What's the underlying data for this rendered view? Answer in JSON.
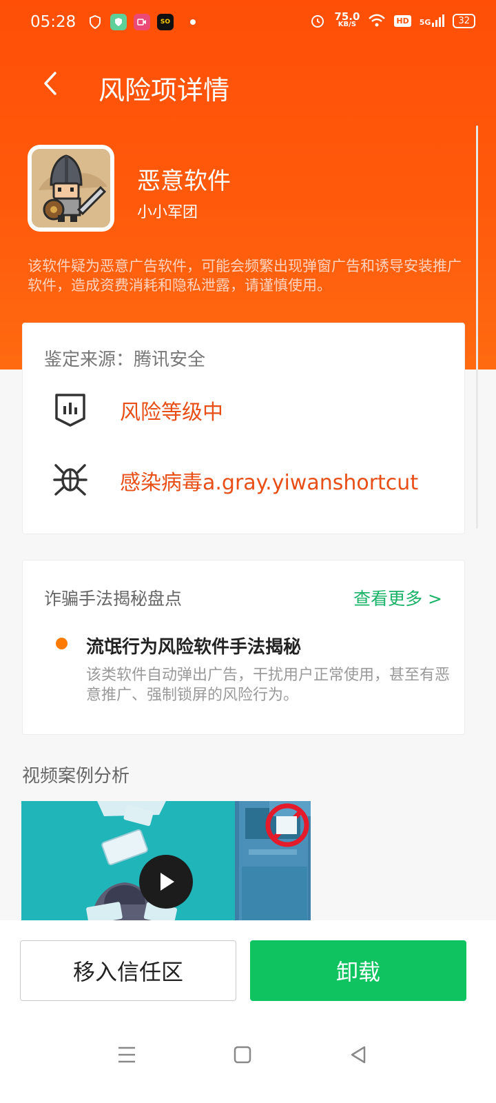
{
  "status_bar": {
    "time": "05:28",
    "speed_value": "75.0",
    "speed_unit": "KB/S",
    "hd_label": "HD",
    "network": "5G",
    "battery": "32"
  },
  "header": {
    "title": "风险项详情"
  },
  "app": {
    "name": "恶意软件",
    "publisher": "小小军团",
    "description": "该软件疑为恶意广告软件，可能会频繁出现弹窗广告和诱导安装推广软件，造成资费消耗和隐私泄露，请谨慎使用。"
  },
  "risk_card": {
    "source": "鉴定来源：腾讯安全",
    "level_text": "风险等级中",
    "virus_text": "感染病毒a.gray.yiwanshortcut"
  },
  "fraud_card": {
    "heading": "诈骗手法揭秘盘点",
    "more_label": "查看更多 >",
    "item": {
      "title": "流氓行为风险软件手法揭秘",
      "description": "该类软件自动弹出广告，干扰用户正常使用，甚至有恶意推广、强制锁屏的风险行为。"
    }
  },
  "video_section": {
    "title": "视频案例分析"
  },
  "actions": {
    "trust_label": "移入信任区",
    "uninstall_label": "卸载"
  },
  "colors": {
    "header_orange": "#ff5208",
    "risk_orange": "#e84e16",
    "link_green": "#19b368",
    "uninstall_green": "#0fc460",
    "dot_orange": "#ff7a00"
  },
  "icons": [
    "back-arrow-icon",
    "risk-level-icon",
    "virus-bug-icon",
    "play-icon",
    "menu-icon",
    "home-icon",
    "back-icon"
  ]
}
